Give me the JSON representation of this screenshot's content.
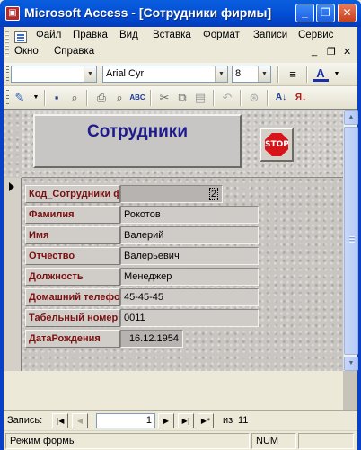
{
  "window": {
    "title": "Microsoft Access - [Сотрудники фирмы]",
    "minimize_glyph": "_",
    "restore_glyph": "❐",
    "close_glyph": "✕"
  },
  "menubar": {
    "items": [
      "Файл",
      "Правка",
      "Вид",
      "Вставка",
      "Формат",
      "Записи",
      "Сервис",
      "Окно",
      "Справка"
    ],
    "doc_controls": [
      "_",
      "❐",
      "✕"
    ]
  },
  "format_toolbar": {
    "object_combo_value": "",
    "font_name": "Arial Cyr",
    "font_size": "8",
    "icons": [
      "align-icon",
      "font-color-icon"
    ],
    "font_color_glyph": "A"
  },
  "form_toolbar": {
    "icons": [
      "design-view-icon",
      "save-icon",
      "search-file-icon",
      "print-icon",
      "print-preview-icon",
      "spelling-icon",
      "cut-icon",
      "copy-icon",
      "paste-icon",
      "undo-icon",
      "hyperlink-icon",
      "sort-ascending-icon",
      "sort-descending-icon"
    ]
  },
  "form": {
    "header_title": "Сотрудники",
    "stop_button_label": "STOP",
    "fields": [
      {
        "label": "Код_Сотрудники ф",
        "value": "2"
      },
      {
        "label": "Фамилия",
        "value": "Рокотов"
      },
      {
        "label": "Имя",
        "value": "Валерий"
      },
      {
        "label": "Отчество",
        "value": "Валерьевич"
      },
      {
        "label": "Должность",
        "value": "Менеджер"
      },
      {
        "label": "Домашний телефо",
        "value": "45-45-45"
      },
      {
        "label": "Табельный номер",
        "value": "0011"
      },
      {
        "label": "ДатаРождения",
        "value": "16.12.1954"
      }
    ]
  },
  "navigation": {
    "label": "Запись:",
    "current_record": "1",
    "of_label": "из",
    "total_records": "11"
  },
  "status": {
    "mode": "Режим формы",
    "num_indicator": "NUM"
  },
  "colors": {
    "title_text": "#1e1b8c",
    "label_text": "#7a0f0f",
    "titlebar": "#0453d8"
  }
}
